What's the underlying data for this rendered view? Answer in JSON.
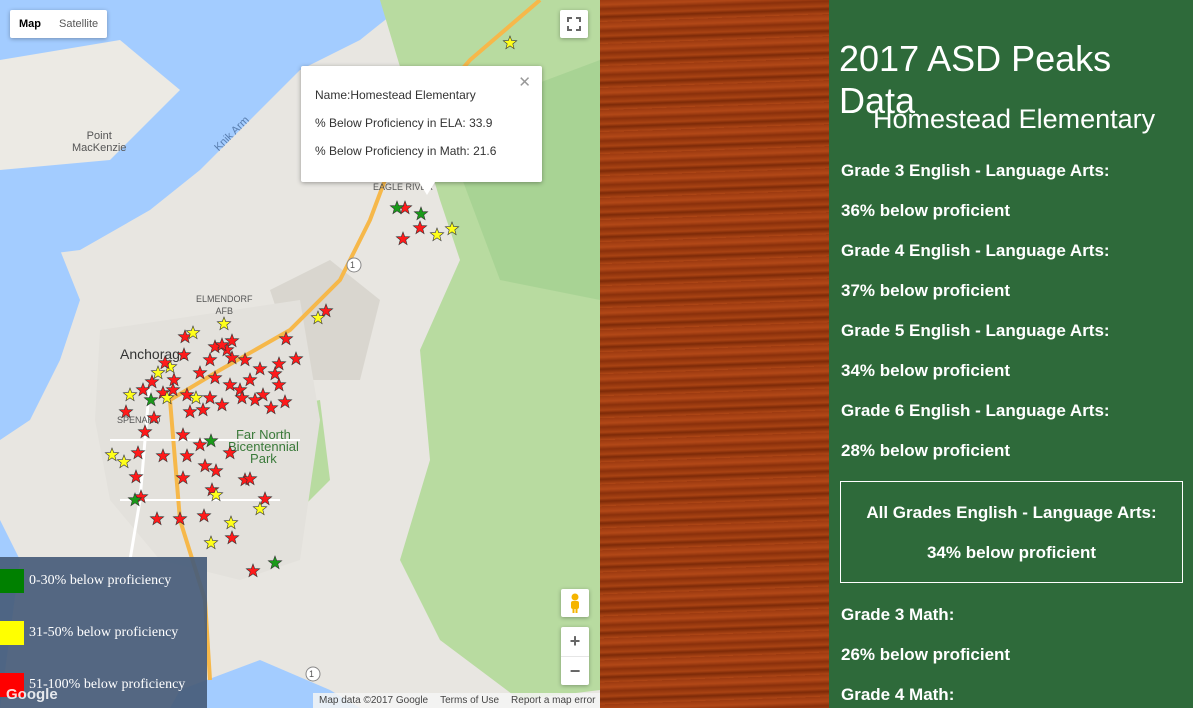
{
  "map": {
    "type_buttons": [
      "Map",
      "Satellite"
    ],
    "active_type": "Map",
    "place_labels": {
      "point_mackenzie": "Point\nMacKenzie",
      "knik_arm": "Knik Arm",
      "eagle_river": "EAGLE RIVER",
      "elmendorf": "ELMENDORF\nAFB",
      "anchorage": "Anchorage",
      "spenard": "SPENARD",
      "park": "Far North\nBicentennial\nPark",
      "hwy_1": "1"
    },
    "info_window": {
      "name": "Name:Homestead Elementary",
      "ela": "% Below Proficiency in ELA: 33.9",
      "math": "% Below Proficiency in Math: 21.6"
    },
    "attribution": [
      "Map data ©2017 Google",
      "Terms of Use",
      "Report a map error"
    ],
    "google_logo": "Google",
    "legend": [
      {
        "color": "#008000",
        "label": "0-30% below proficiency"
      },
      {
        "color": "#ffff00",
        "label": "31-50% below proficiency"
      },
      {
        "color": "#ff0000",
        "label": "51-100% below proficiency"
      }
    ],
    "colors": {
      "red": "#ff1a1a",
      "yellow": "#ffff1a",
      "green": "#1a9a1a"
    }
  },
  "panel": {
    "title": "2017 ASD Peaks Data",
    "school": "Homestead Elementary",
    "rows": [
      "Grade 3 English - Language Arts:",
      "36% below proficient",
      "Grade 4 English - Language Arts:",
      "37% below proficient",
      "Grade 5 English - Language Arts:",
      "34% below proficient",
      "Grade 6 English - Language Arts:",
      "28% below proficient"
    ],
    "all_grades_label": "All Grades English - Language Arts:",
    "all_grades_value": "34% below proficient",
    "math_rows": [
      "Grade 3 Math:",
      "26% below proficient",
      "Grade 4 Math:"
    ]
  }
}
